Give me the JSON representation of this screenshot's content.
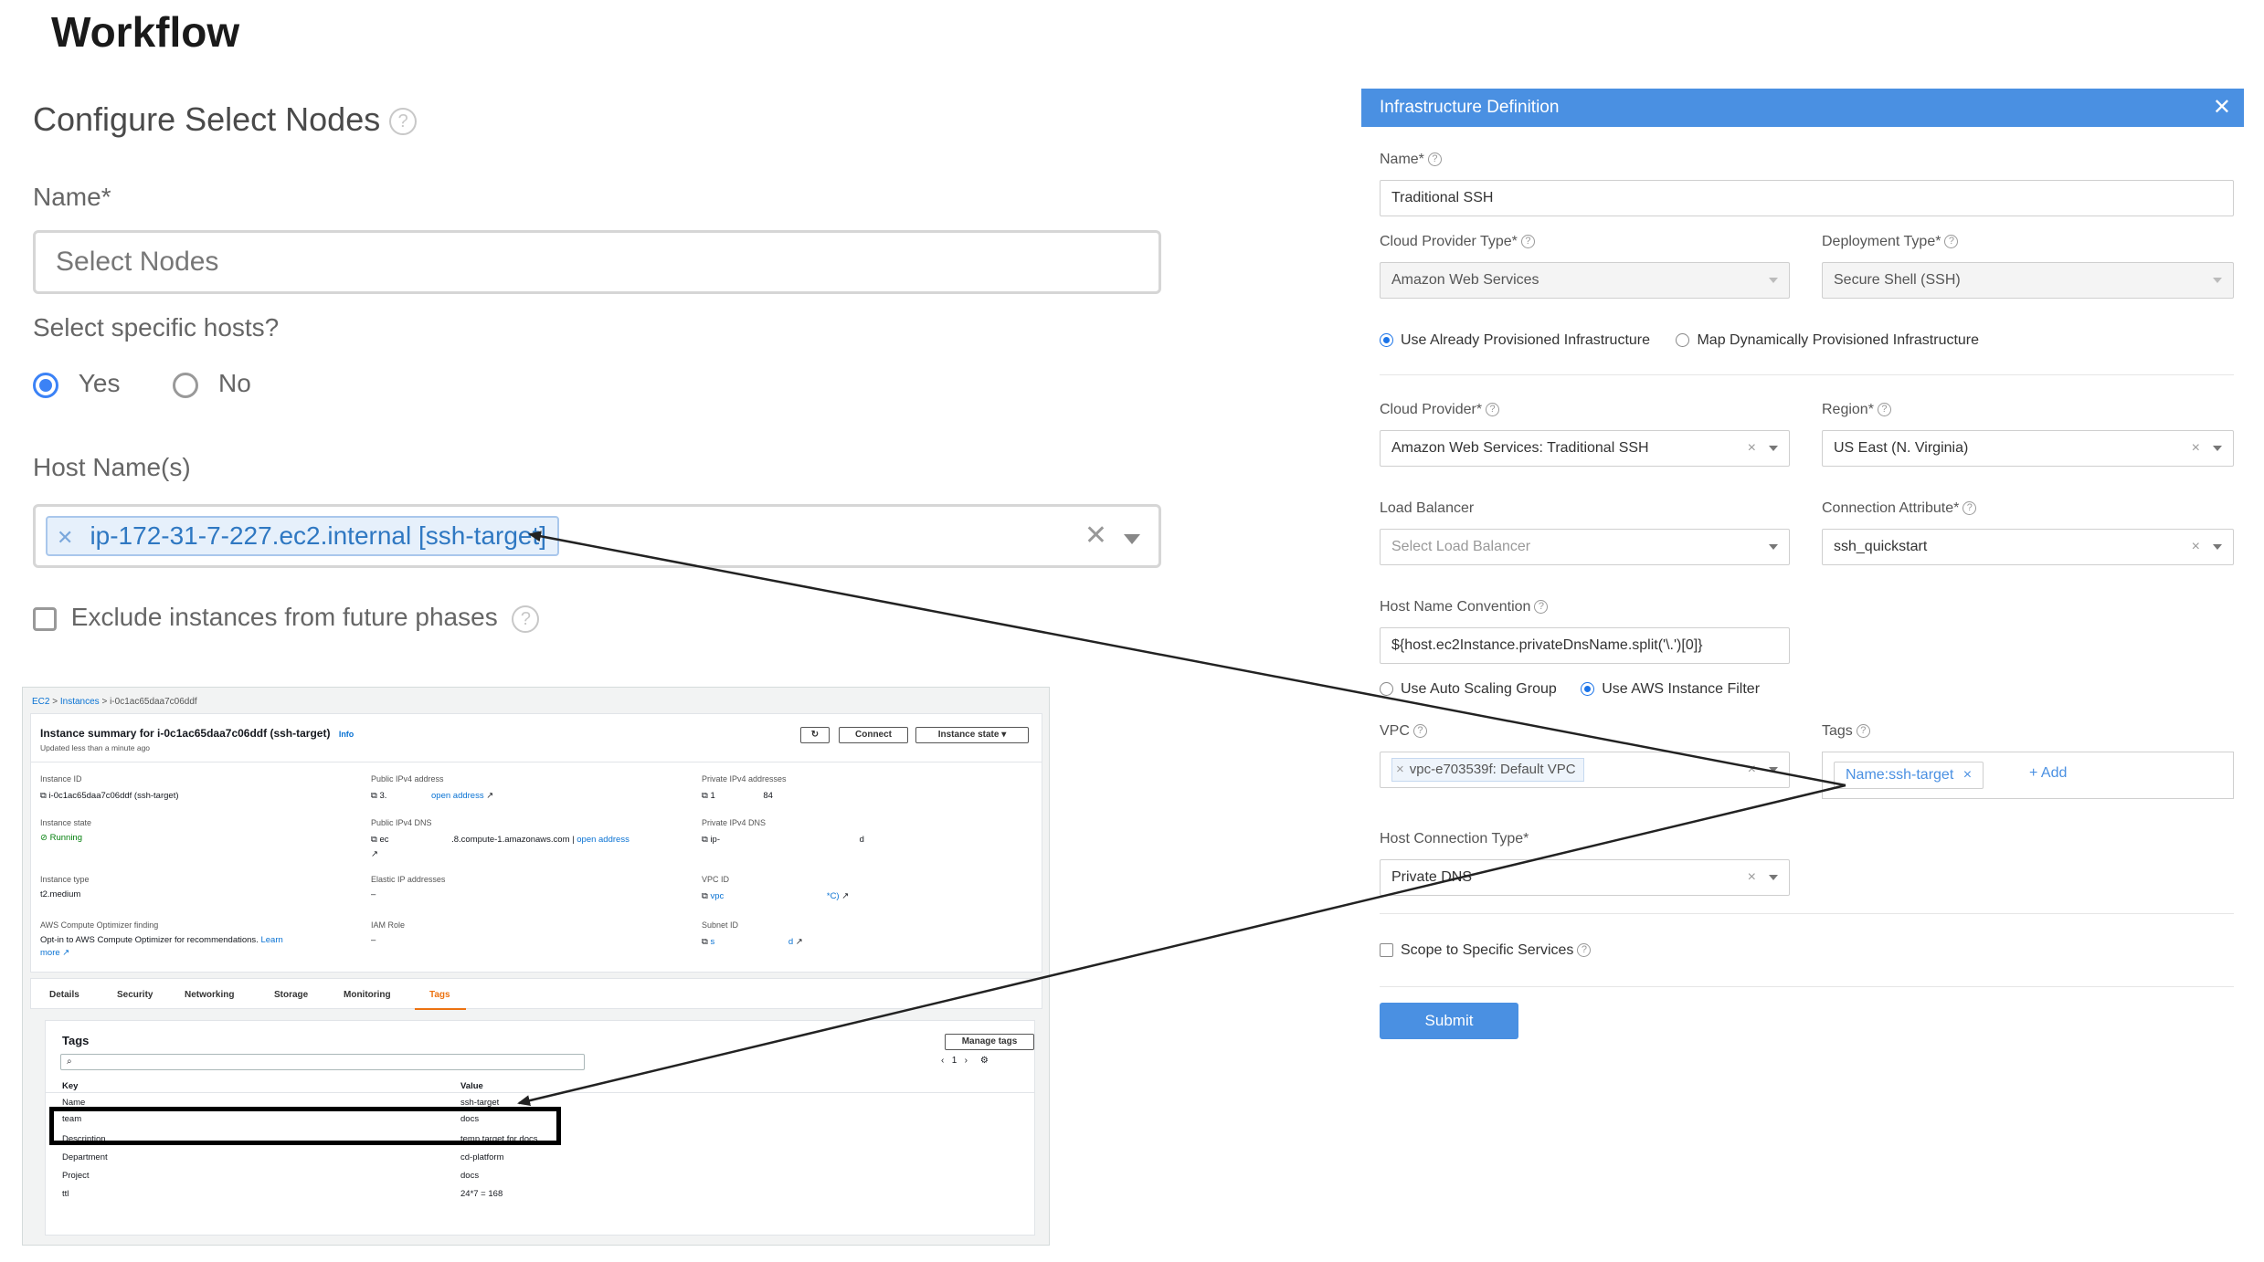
{
  "page": {
    "title": "Workflow"
  },
  "configure": {
    "heading": "Configure Select Nodes",
    "name_label": "Name*",
    "name_value": "Select Nodes",
    "specific_hosts_label": "Select specific hosts?",
    "yes_label": "Yes",
    "no_label": "No",
    "selected": "Yes",
    "host_names_label": "Host Name(s)",
    "host_chip": "ip-172-31-7-227.ec2.internal [ssh-target]",
    "exclude_label": "Exclude instances from future phases"
  },
  "aws": {
    "breadcrumb": [
      "EC2",
      "Instances",
      "i-0c1ac65daa7c06ddf"
    ],
    "summary_title": "Instance summary for i-0c1ac65daa7c06ddf (ssh-target)",
    "info": "Info",
    "updated": "Updated less than a minute ago",
    "connect": "Connect",
    "instance_state_btn": "Instance state",
    "fields": {
      "instance_id_k": "Instance ID",
      "instance_id_v": "i-0c1ac65daa7c06ddf (ssh-target)",
      "public_ipv4_k": "Public IPv4 address",
      "public_ipv4_v": "3.",
      "open_address": "open address",
      "private_ipv4_k": "Private IPv4 addresses",
      "private_ipv4_v1": "1",
      "private_ipv4_v2": "84",
      "instance_state_k": "Instance state",
      "instance_state_v": "Running",
      "public_dns_k": "Public IPv4 DNS",
      "public_dns_v1": "ec",
      "public_dns_v2": ".8.compute-1.amazonaws.com |",
      "private_dns_k": "Private IPv4 DNS",
      "private_dns_v1": "ip-",
      "private_dns_v2": "d",
      "instance_type_k": "Instance type",
      "instance_type_v": "t2.medium",
      "elastic_ip_k": "Elastic IP addresses",
      "elastic_ip_v": "–",
      "vpc_id_k": "VPC ID",
      "vpc_id_v1": "vpc",
      "vpc_id_v2": "*C)",
      "optimizer_k": "AWS Compute Optimizer finding",
      "optimizer_v": "Opt-in to AWS Compute Optimizer for recommendations.",
      "learn": "Learn",
      "more": "more",
      "iam_k": "IAM Role",
      "iam_v": "–",
      "subnet_k": "Subnet ID",
      "subnet_v1": "s",
      "subnet_v2": "d"
    },
    "tabs": [
      "Details",
      "Security",
      "Networking",
      "Storage",
      "Monitoring",
      "Tags"
    ],
    "tags_heading": "Tags",
    "manage_tags": "Manage tags",
    "page_num": "1",
    "col_key": "Key",
    "col_value": "Value",
    "rows": [
      {
        "key": "Name",
        "value": "ssh-target"
      },
      {
        "key": "team",
        "value": "docs"
      },
      {
        "key": "Description",
        "value": "temp target for docs"
      },
      {
        "key": "Department",
        "value": "cd-platform"
      },
      {
        "key": "Project",
        "value": "docs"
      },
      {
        "key": "ttl",
        "value": "24*7 = 168"
      }
    ]
  },
  "infra": {
    "header": "Infrastructure Definition",
    "name_label": "Name*",
    "name_value": "Traditional SSH",
    "cloud_provider_type_label": "Cloud Provider Type*",
    "cloud_provider_type_value": "Amazon Web Services",
    "deployment_type_label": "Deployment Type*",
    "deployment_type_value": "Secure Shell (SSH)",
    "radio_provisioned": "Use Already Provisioned Infrastructure",
    "radio_dynamic": "Map Dynamically Provisioned Infrastructure",
    "cloud_provider_label": "Cloud Provider*",
    "cloud_provider_value": "Amazon Web Services: Traditional SSH",
    "region_label": "Region*",
    "region_value": "US East (N. Virginia)",
    "load_balancer_label": "Load Balancer",
    "load_balancer_placeholder": "Select Load Balancer",
    "connection_attr_label": "Connection Attribute*",
    "connection_attr_value": "ssh_quickstart",
    "host_name_conv_label": "Host Name Convention",
    "host_name_conv_value": "${host.ec2Instance.privateDnsName.split('\\.')[0]}",
    "radio_asg": "Use Auto Scaling Group",
    "radio_filter": "Use AWS Instance Filter",
    "vpc_label": "VPC",
    "vpc_chip": "vpc-e703539f: Default VPC",
    "tags_label": "Tags",
    "tag_chip": "Name:ssh-target",
    "add_label": "+ Add",
    "host_conn_type_label": "Host Connection Type*",
    "host_conn_type_value": "Private DNS",
    "scope_label": "Scope to Specific Services",
    "submit": "Submit"
  }
}
